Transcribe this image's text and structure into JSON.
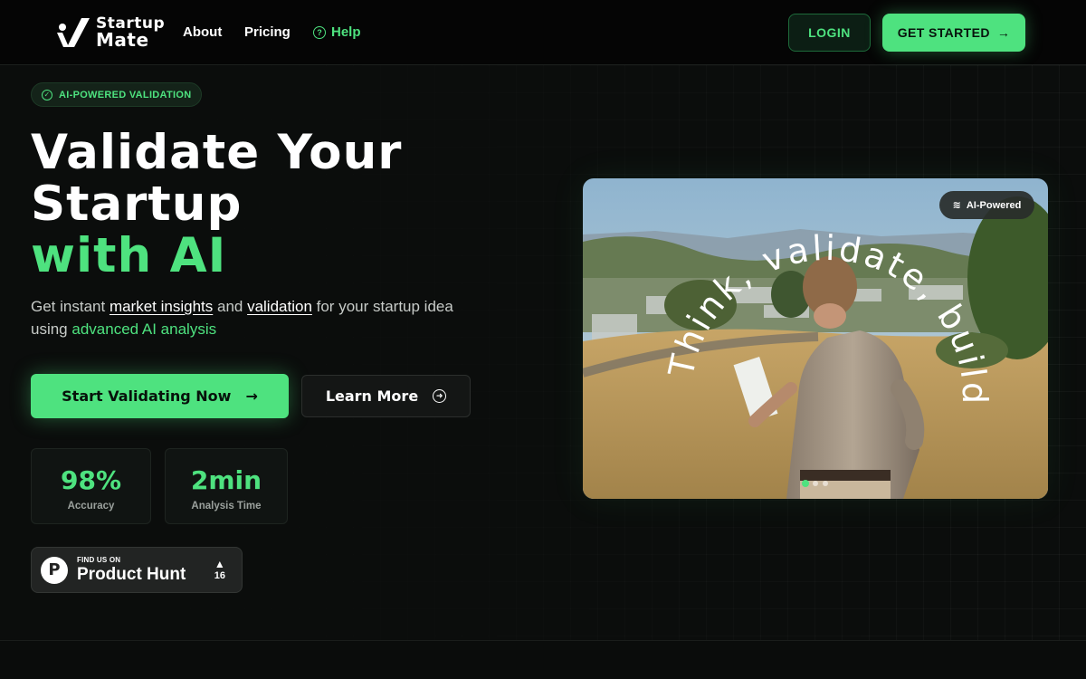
{
  "brand": {
    "line1": "Startup",
    "line2": "Mate"
  },
  "nav": {
    "about": "About",
    "pricing": "Pricing",
    "help": "Help",
    "help_icon": "question-circle-icon",
    "login": "LOGIN",
    "get_started": "GET STARTED",
    "arrow": "→"
  },
  "hero": {
    "badge": "AI-POWERED VALIDATION",
    "badge_icon": "check-circle-icon",
    "headline_line1": "Validate Your",
    "headline_line2": "Startup",
    "headline_line3": "with AI",
    "sub_prefix": "Get instant ",
    "sub_link1": "market insights",
    "sub_mid": " and ",
    "sub_link2": "validation",
    "sub_mid2": " for your startup idea using ",
    "sub_highlight": "advanced AI analysis",
    "cta_primary": "Start Validating Now",
    "cta_primary_arrow": "→",
    "cta_secondary": "Learn More",
    "cta_secondary_icon": "arrow-right-circle-icon"
  },
  "stats": [
    {
      "value": "98%",
      "label": "Accuracy"
    },
    {
      "value": "2min",
      "label": "Analysis Time"
    }
  ],
  "product_hunt": {
    "small": "FIND US ON",
    "big": "Product Hunt",
    "logo_letter": "P",
    "arrow": "▲",
    "votes": "16"
  },
  "image": {
    "pill": "AI-Powered",
    "pill_icon": "layers-icon",
    "arc_text": "Think, validate, build.",
    "carousel_dots": 3,
    "active_dot": 0
  },
  "colors": {
    "accent": "#4ee27f",
    "background": "#0b0d0c"
  }
}
